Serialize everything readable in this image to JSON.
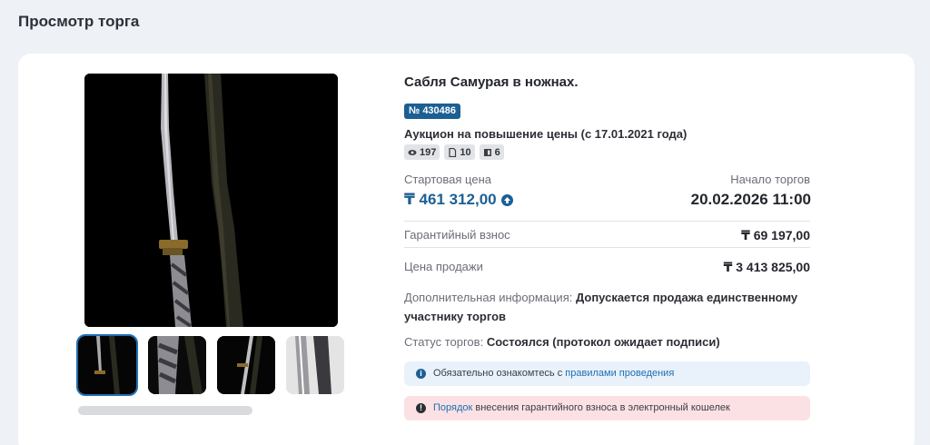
{
  "page": {
    "title": "Просмотр торга"
  },
  "lot": {
    "title": "Сабля Самурая в ножнах.",
    "number": "№ 430486",
    "auction_type": "Аукцион на повышение цены (с 17.01.2021 года)",
    "stats": {
      "views": "197",
      "docs": "10",
      "files": "6"
    }
  },
  "prices": {
    "start_price_label": "Стартовая цена",
    "start_price": "₸ 461 312,00",
    "start_date_label": "Начало торгов",
    "start_date": "20.02.2026 11:00",
    "guarantee_label": "Гарантийный взнос",
    "guarantee": "₸ 69 197,00",
    "sale_label": "Цена продажи",
    "sale": "₸ 3 413 825,00"
  },
  "extra": {
    "label": "Дополнительная информация:",
    "value": "Допускается продажа единственному участнику торгов"
  },
  "status": {
    "label": "Статус торгов:",
    "value": "Состоялся (протокол ожидает подписи)"
  },
  "notices": {
    "info_prefix": "Обязательно ознакомтесь с",
    "info_link": "правилами проведения",
    "warn_link": "Порядок",
    "warn_suffix": "внесения гарантийного взноса в электронный кошелек"
  },
  "colors": {
    "accent": "#1c5f93",
    "warn_bg": "#fbe1e3",
    "info_bg": "#e9f1fb"
  },
  "icons": [
    "eye-icon",
    "document-icon",
    "file-icon",
    "arrow-up-icon",
    "info-icon",
    "alert-icon"
  ]
}
